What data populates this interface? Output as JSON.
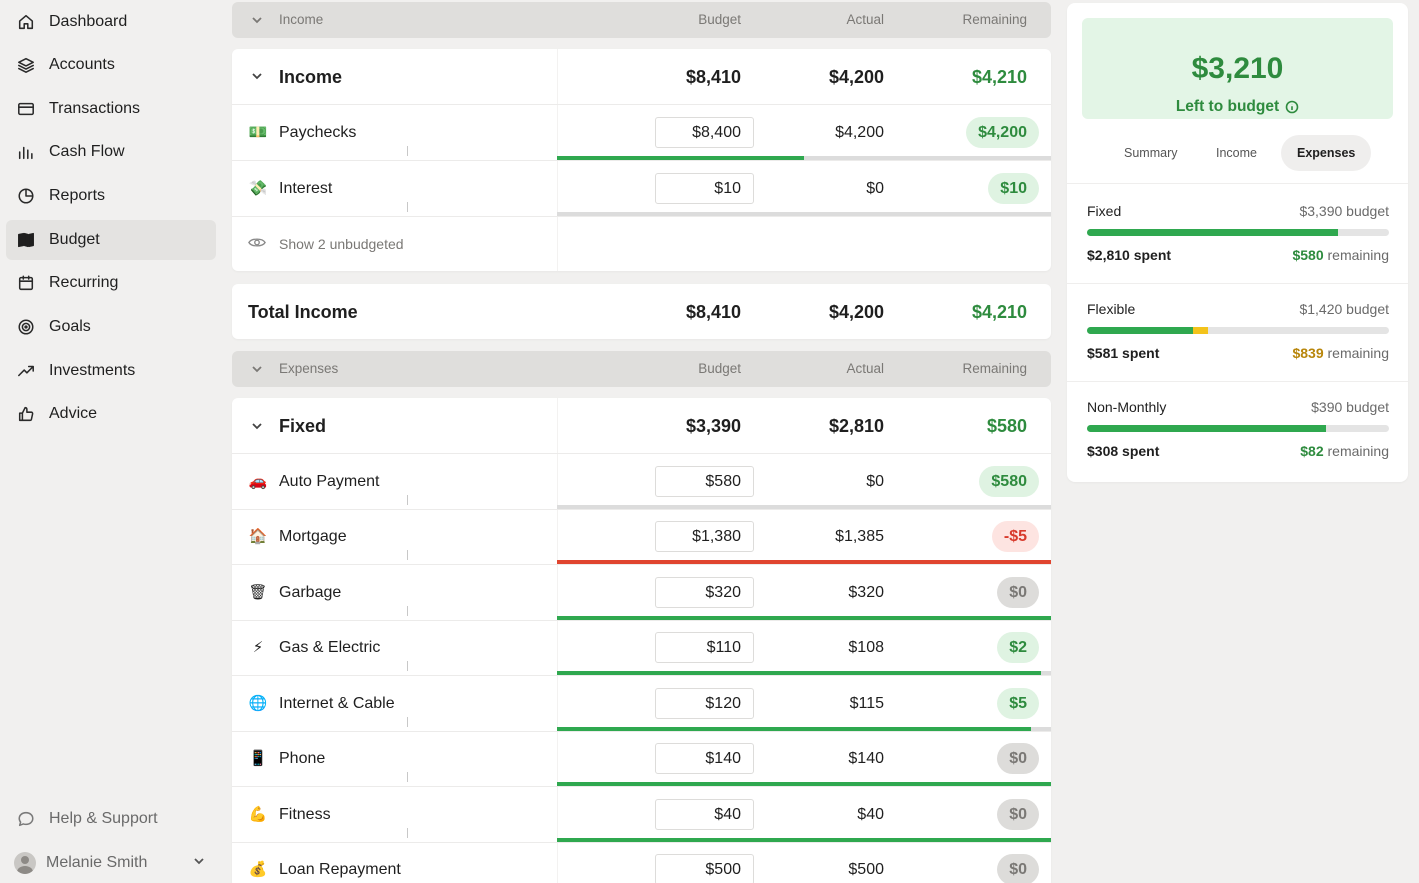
{
  "sidebar": {
    "items": [
      {
        "label": "Dashboard",
        "icon": "home-icon"
      },
      {
        "label": "Accounts",
        "icon": "layers-icon"
      },
      {
        "label": "Transactions",
        "icon": "card-icon"
      },
      {
        "label": "Cash Flow",
        "icon": "bar-chart-icon"
      },
      {
        "label": "Reports",
        "icon": "pie-chart-icon"
      },
      {
        "label": "Budget",
        "icon": "map-icon"
      },
      {
        "label": "Recurring",
        "icon": "calendar-icon"
      },
      {
        "label": "Goals",
        "icon": "target-icon"
      },
      {
        "label": "Investments",
        "icon": "trend-up-icon"
      },
      {
        "label": "Advice",
        "icon": "thumbs-up-icon"
      }
    ],
    "help_label": "Help & Support",
    "user_name": "Melanie Smith"
  },
  "income_header": {
    "title": "Income",
    "budget": "Budget",
    "actual": "Actual",
    "remaining": "Remaining"
  },
  "income_group": {
    "title": "Income",
    "budget": "$8,410",
    "actual": "$4,200",
    "remaining": "$4,210"
  },
  "income_items": [
    {
      "icon": "💵",
      "name": "Paychecks",
      "budget": "$8,400",
      "actual": "$4,200",
      "remaining": "$4,200",
      "status": "g",
      "progress": 0.5,
      "bar_color": "#2fa84f"
    },
    {
      "icon": "💸",
      "name": "Interest",
      "budget": "$10",
      "actual": "$0",
      "remaining": "$10",
      "status": "g",
      "progress": 0,
      "bar_color": "#2fa84f"
    }
  ],
  "show_unbudgeted": "Show 2 unbudgeted",
  "total_income": {
    "label": "Total Income",
    "budget": "$8,410",
    "actual": "$4,200",
    "remaining": "$4,210"
  },
  "expenses_header": {
    "title": "Expenses",
    "budget": "Budget",
    "actual": "Actual",
    "remaining": "Remaining"
  },
  "fixed_group": {
    "title": "Fixed",
    "budget": "$3,390",
    "actual": "$2,810",
    "remaining": "$580"
  },
  "fixed_items": [
    {
      "icon": "🚗",
      "name": "Auto Payment",
      "budget": "$580",
      "actual": "$0",
      "remaining": "$580",
      "status": "g",
      "progress": 0,
      "bar_color": "#2fa84f"
    },
    {
      "icon": "🏠",
      "name": "Mortgage",
      "budget": "$1,380",
      "actual": "$1,385",
      "remaining": "-$5",
      "status": "r",
      "progress": 1,
      "bar_color": "#e0452f"
    },
    {
      "icon": "🗑",
      "name": "Garbage",
      "budget": "$320",
      "actual": "$320",
      "remaining": "$0",
      "status": "n",
      "progress": 1,
      "bar_color": "#2fa84f"
    },
    {
      "icon": "⚡",
      "name": "Gas & Electric",
      "budget": "$110",
      "actual": "$108",
      "remaining": "$2",
      "status": "g",
      "progress": 0.98,
      "bar_color": "#2fa84f"
    },
    {
      "icon": "🌐",
      "name": "Internet & Cable",
      "budget": "$120",
      "actual": "$115",
      "remaining": "$5",
      "status": "g",
      "progress": 0.96,
      "bar_color": "#2fa84f"
    },
    {
      "icon": "📱",
      "name": "Phone",
      "budget": "$140",
      "actual": "$140",
      "remaining": "$0",
      "status": "n",
      "progress": 1,
      "bar_color": "#2fa84f"
    },
    {
      "icon": "💪",
      "name": "Fitness",
      "budget": "$40",
      "actual": "$40",
      "remaining": "$0",
      "status": "n",
      "progress": 1,
      "bar_color": "#2fa84f"
    },
    {
      "icon": "💰",
      "name": "Loan Repayment",
      "budget": "$500",
      "actual": "$500",
      "remaining": "$0",
      "status": "n",
      "progress": 1,
      "bar_color": "#2fa84f"
    }
  ],
  "summary": {
    "left_amount": "$3,210",
    "left_label": "Left to budget",
    "tabs": [
      "Summary",
      "Income",
      "Expenses"
    ],
    "active_tab": "Expenses",
    "groups": [
      {
        "name": "Fixed",
        "budget": "$3,390 budget",
        "spent": "$2,810 spent",
        "remaining_amt": "$580",
        "remaining_word": "remaining",
        "progress": 0.83,
        "over": 0,
        "amber": false
      },
      {
        "name": "Flexible",
        "budget": "$1,420 budget",
        "spent": "$581 spent",
        "remaining_amt": "$839",
        "remaining_word": "remaining",
        "progress": 0.35,
        "over": 0.05,
        "amber": true
      },
      {
        "name": "Non-Monthly",
        "budget": "$390 budget",
        "spent": "$308 spent",
        "remaining_amt": "$82",
        "remaining_word": "remaining",
        "progress": 0.79,
        "over": 0,
        "amber": false
      }
    ]
  },
  "colors": {
    "green": "#2e8b3e",
    "red": "#d83a2c",
    "bar_green": "#2fa84f",
    "bar_red": "#e0452f",
    "amber": "#f3c31b"
  }
}
